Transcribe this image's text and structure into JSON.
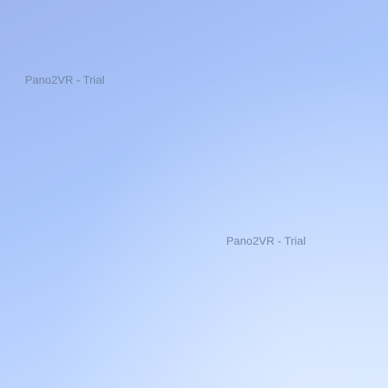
{
  "panorama": {
    "watermarks": [
      {
        "text": "Pano2VR - Trial"
      },
      {
        "text": "Pano2VR - Trial"
      }
    ]
  },
  "colors": {
    "sky_top_left": "#9db6ee",
    "sky_bottom_right": "#d7e7ff",
    "watermark_text": "#6e7f9c"
  }
}
